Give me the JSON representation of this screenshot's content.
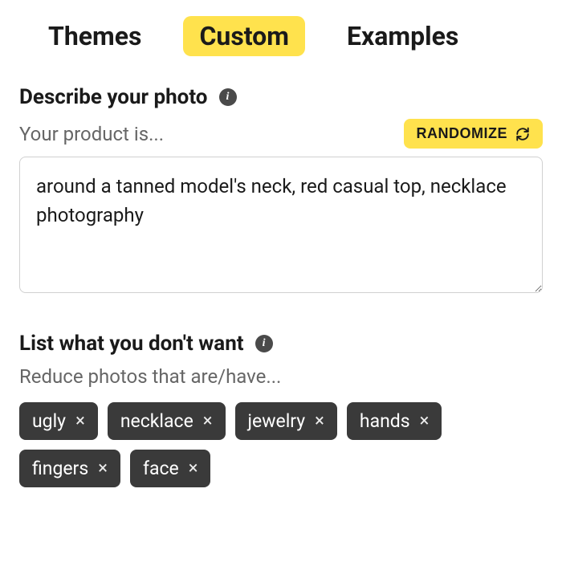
{
  "tabs": {
    "themes": "Themes",
    "custom": "Custom",
    "examples": "Examples",
    "active": "custom"
  },
  "describe": {
    "title": "Describe your photo",
    "sub_label": "Your product is...",
    "randomize_label": "RANDOMIZE",
    "textarea_value": "around a tanned model's neck, red casual top, necklace photography"
  },
  "exclude": {
    "title": "List what you don't want",
    "sub_label": "Reduce photos that are/have...",
    "tags": [
      "ugly",
      "necklace",
      "jewelry",
      "hands",
      "fingers",
      "face"
    ]
  },
  "icons": {
    "info": "i",
    "close": "×"
  }
}
